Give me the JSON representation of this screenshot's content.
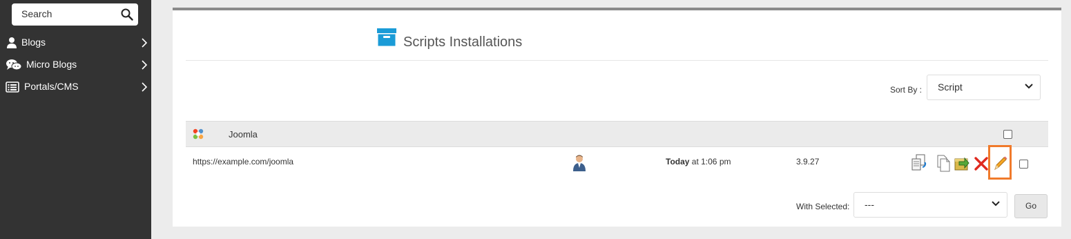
{
  "sidebar": {
    "search_placeholder": "Search",
    "items": [
      {
        "label": "Blogs",
        "icon": "user-icon"
      },
      {
        "label": "Micro Blogs",
        "icon": "chat-bubbles-icon"
      },
      {
        "label": "Portals/CMS",
        "icon": "list-card-icon"
      }
    ]
  },
  "main": {
    "title": "Scripts Installations",
    "sort_by_label": "Sort By :",
    "sort_by_value": "Script",
    "group": {
      "name": "Joomla",
      "icon": "joomla-logo-icon"
    },
    "installation": {
      "url": "https://example.com/joomla",
      "date_bold": "Today",
      "date_rest": " at 1:06 pm",
      "version": "3.9.27",
      "actions": [
        "upgrade-icon",
        "clone-icon",
        "backup-icon",
        "remove-icon",
        "edit-icon"
      ]
    },
    "with_selected_label": "With Selected:",
    "with_selected_value": "---",
    "go_label": "Go"
  },
  "colors": {
    "sidebar_bg": "#333333",
    "highlight": "#f07a2b",
    "title_icon": "#1a9bd7"
  }
}
